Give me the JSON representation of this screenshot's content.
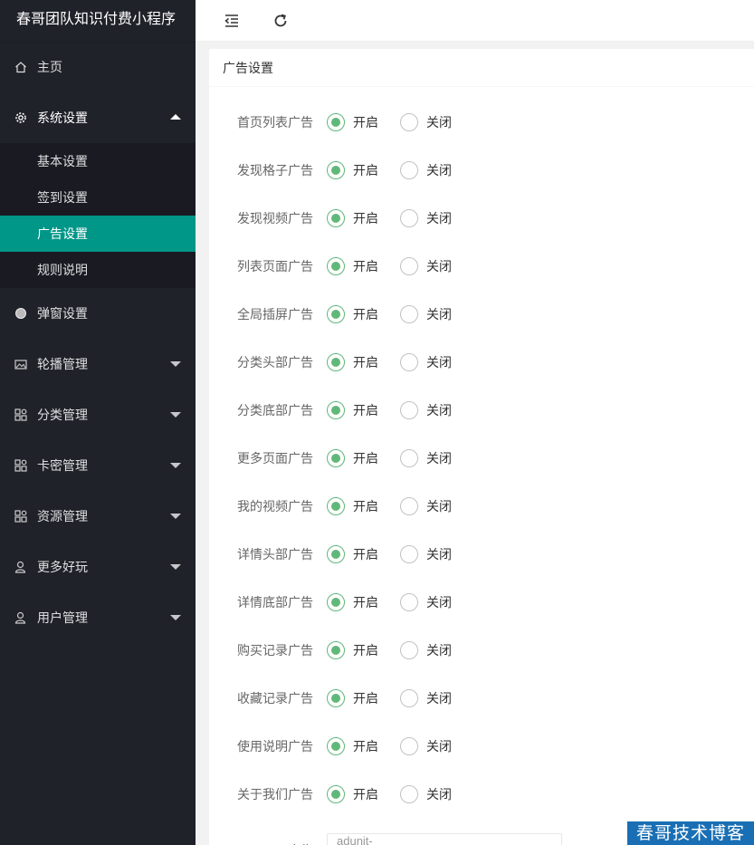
{
  "app": {
    "title": "春哥团队知识付费小程序"
  },
  "sidebar": {
    "items": [
      {
        "label": "主页",
        "icon": "home-icon"
      },
      {
        "label": "系统设置",
        "icon": "gear-icon",
        "expanded": true,
        "children": [
          {
            "label": "基本设置"
          },
          {
            "label": "签到设置"
          },
          {
            "label": "广告设置",
            "active": true
          },
          {
            "label": "规则说明"
          }
        ]
      },
      {
        "label": "弹窗设置",
        "icon": "circle-icon"
      },
      {
        "label": "轮播管理",
        "icon": "image-icon"
      },
      {
        "label": "分类管理",
        "icon": "apps-icon"
      },
      {
        "label": "卡密管理",
        "icon": "apps-icon"
      },
      {
        "label": "资源管理",
        "icon": "apps-icon"
      },
      {
        "label": "更多好玩",
        "icon": "user-icon"
      },
      {
        "label": "用户管理",
        "icon": "user-icon"
      }
    ]
  },
  "header": {
    "toggle_icon": "indent-icon",
    "refresh_icon": "refresh-icon"
  },
  "panel": {
    "title": "广告设置",
    "on_label": "开启",
    "off_label": "关闭",
    "settings": [
      {
        "label": "首页列表广告",
        "value": "on"
      },
      {
        "label": "发现格子广告",
        "value": "on"
      },
      {
        "label": "发现视频广告",
        "value": "on"
      },
      {
        "label": "列表页面广告",
        "value": "on"
      },
      {
        "label": "全局插屏广告",
        "value": "on"
      },
      {
        "label": "分类头部广告",
        "value": "on"
      },
      {
        "label": "分类底部广告",
        "value": "on"
      },
      {
        "label": "更多页面广告",
        "value": "on"
      },
      {
        "label": "我的视频广告",
        "value": "on"
      },
      {
        "label": "详情头部广告",
        "value": "on"
      },
      {
        "label": "详情底部广告",
        "value": "on"
      },
      {
        "label": "购买记录广告",
        "value": "on"
      },
      {
        "label": "收藏记录广告",
        "value": "on"
      },
      {
        "label": "使用说明广告",
        "value": "on"
      },
      {
        "label": "关于我们广告",
        "value": "on"
      }
    ],
    "banner": {
      "label": "Banner广告",
      "value": "adunit-"
    }
  },
  "watermark": {
    "text": "春哥技术博客"
  },
  "colors": {
    "sidebar_bg": "#20222a",
    "submenu_bg": "#191a22",
    "active": "#009688",
    "radio_checked": "#5fb878"
  }
}
